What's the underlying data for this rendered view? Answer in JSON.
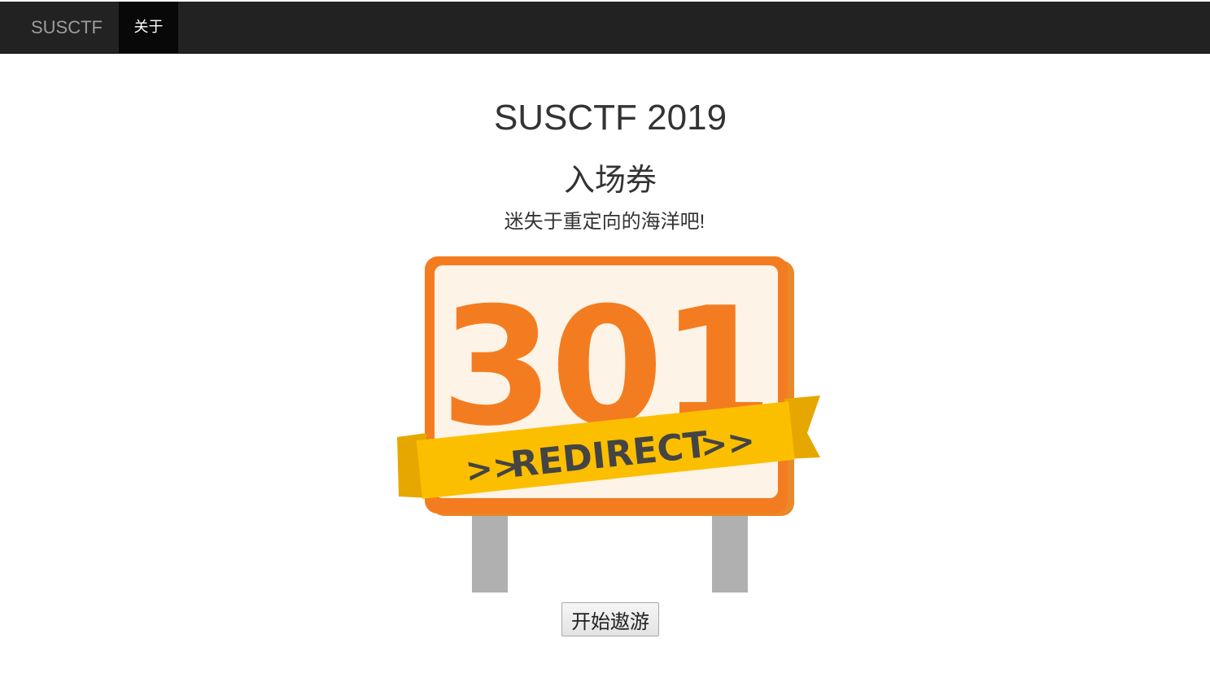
{
  "navbar": {
    "brand": "SUSCTF",
    "items": [
      {
        "label": "关于",
        "active": true
      }
    ]
  },
  "main": {
    "title": "SUSCTF 2019",
    "subtitle": "入场券",
    "tagline": "迷失于重定向的海洋吧!",
    "sign": {
      "code": "301",
      "banner_text": "REDIRECT",
      "banner_left_arrows": ">>",
      "banner_right_arrows": ">>"
    },
    "start_button_label": "开始遨游"
  },
  "colors": {
    "navbar_bg": "#222222",
    "nav_active_bg": "#080808",
    "sign_orange": "#f47c20",
    "sign_inner": "#fdf3e6",
    "banner_yellow": "#fbbf00",
    "post_gray": "#b0b0b0"
  }
}
